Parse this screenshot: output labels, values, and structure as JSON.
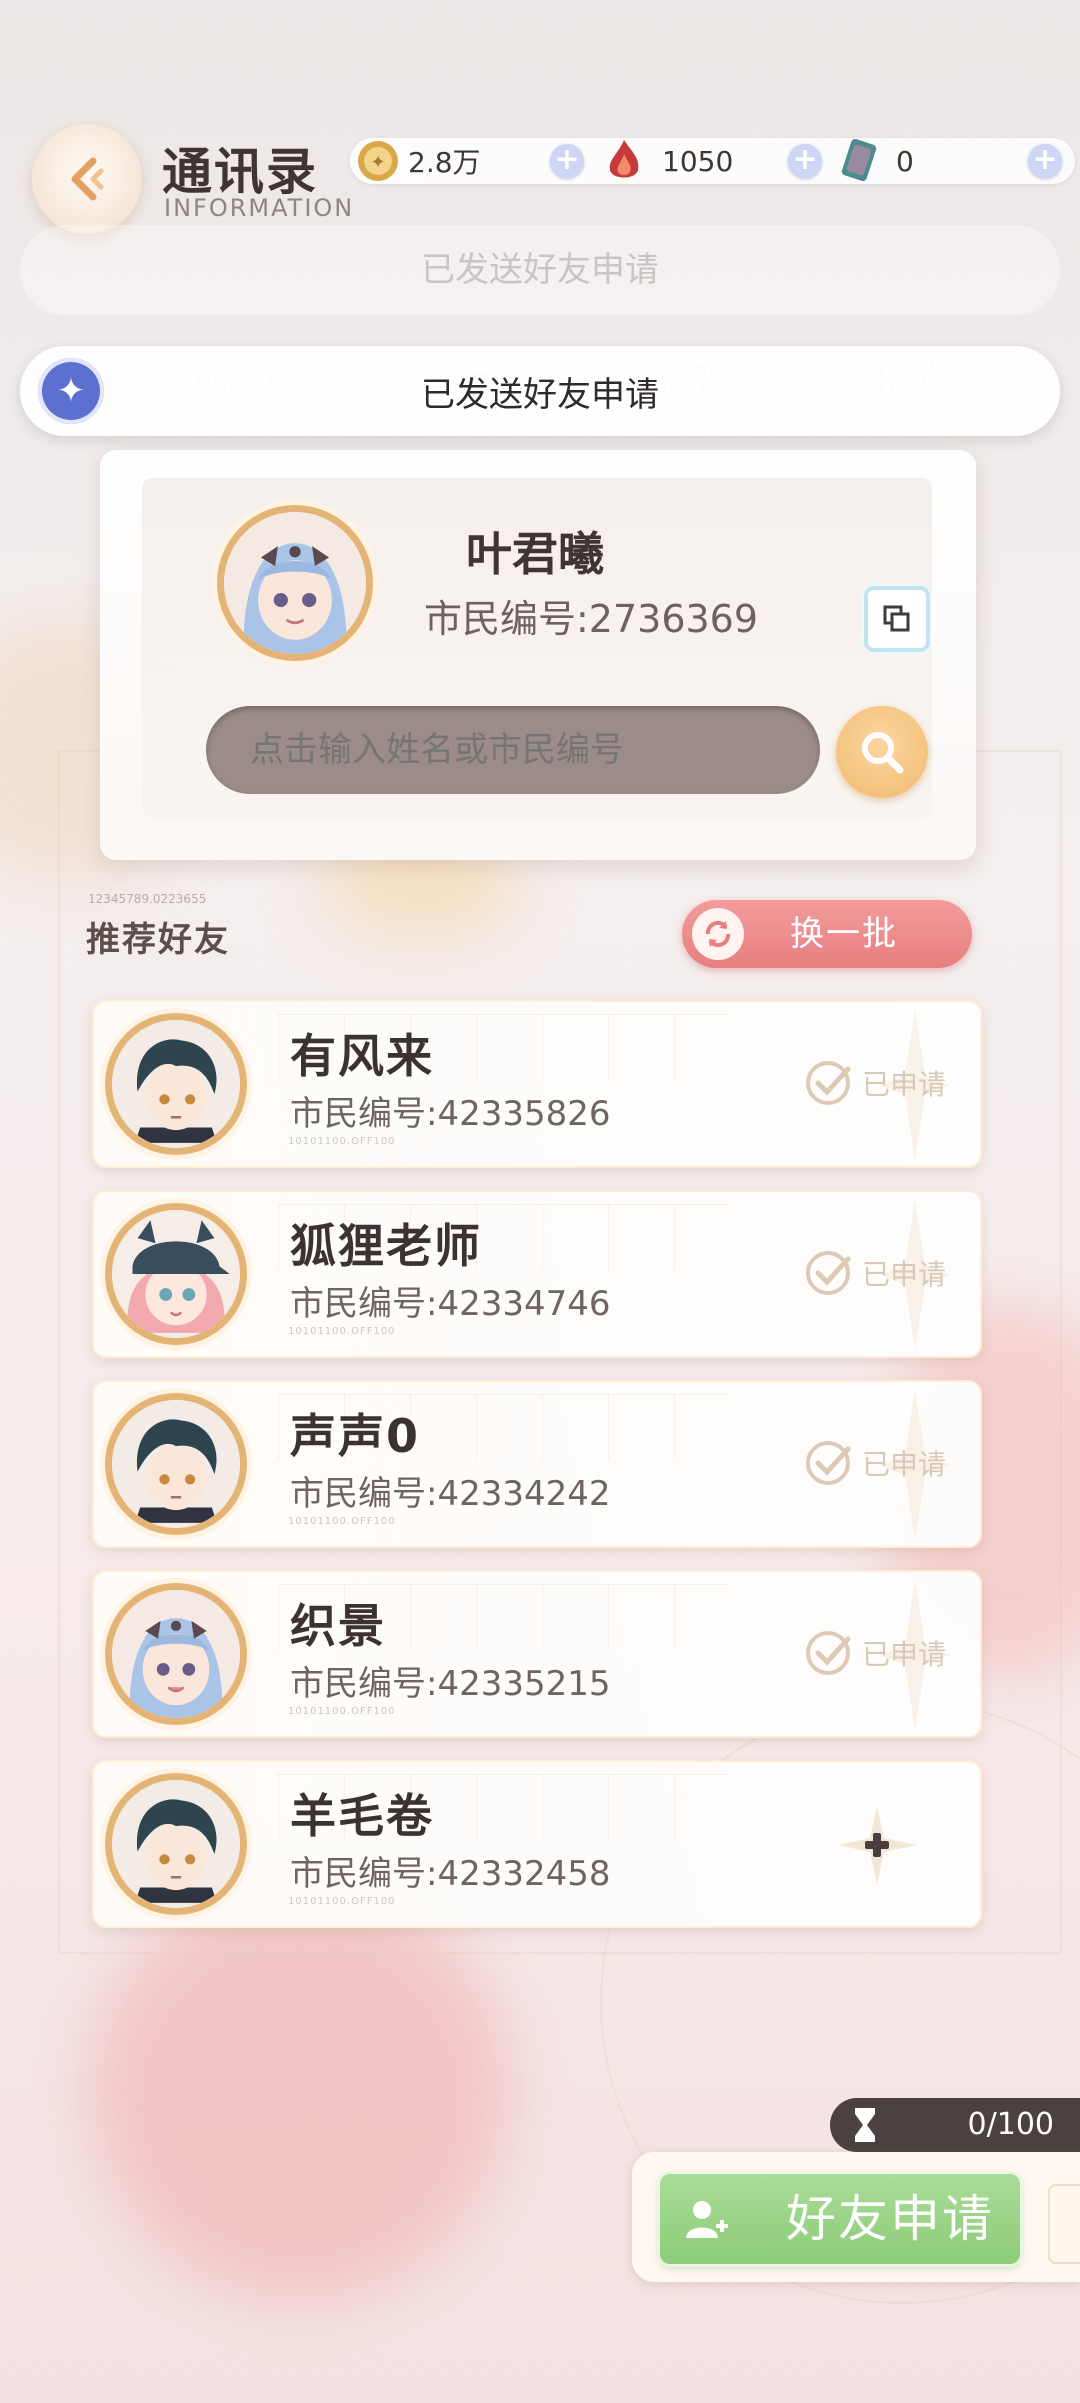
{
  "header": {
    "title": "通讯录",
    "subtitle": "INFORMATION",
    "currencies": [
      {
        "name": "gold-coin",
        "value": "2.8万"
      },
      {
        "name": "red-crystal",
        "value": "1050"
      },
      {
        "name": "card-ticket",
        "value": "0"
      }
    ]
  },
  "background": {
    "ghost_banner": "已发送好友申请",
    "ghost_tabs": [
      "城市",
      "好友",
      "添加",
      "相遇"
    ]
  },
  "toast": {
    "text": "已发送好友申请"
  },
  "profile": {
    "name": "叶君曦",
    "id_label": "市民编号:2736369",
    "search_placeholder": "点击输入姓名或市民编号"
  },
  "recommend": {
    "title": "推荐好友",
    "code": "12345789.0223655",
    "refresh_label": "换一批",
    "friends": [
      {
        "name": "有风来",
        "id_label": "市民编号:42335826",
        "status": "已申请",
        "avatar": "dark-hair-boy"
      },
      {
        "name": "狐狸老师",
        "id_label": "市民编号:42334746",
        "status": "已申请",
        "avatar": "pink-hair-cap-girl"
      },
      {
        "name": "声声0",
        "id_label": "市民编号:42334242",
        "status": "已申请",
        "avatar": "dark-hair-boy"
      },
      {
        "name": "织景",
        "id_label": "市民编号:42335215",
        "status": "已申请",
        "avatar": "blue-hair-girl"
      },
      {
        "name": "羊毛卷",
        "id_label": "市民编号:42332458",
        "status": "",
        "avatar": "dark-hair-boy"
      }
    ],
    "row_code": "10101100.OFF100"
  },
  "footer": {
    "quota": "0/100",
    "apply_label": "好友申请"
  },
  "colors": {
    "accent_green": "#8dcc78",
    "accent_red": "#e77f80",
    "gold": "#e3b475",
    "search_bg": "#9b8c89"
  }
}
